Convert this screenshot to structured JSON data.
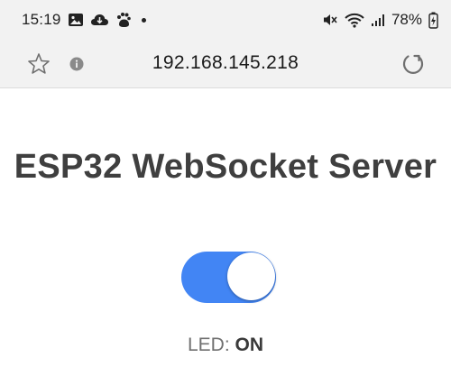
{
  "status_bar": {
    "time": "15:19",
    "battery_percent": "78%",
    "icons": [
      "image-icon",
      "cloud-download-icon",
      "paw-icon",
      "notification-dot-icon",
      "mute-icon",
      "wifi-icon",
      "signal-icon",
      "battery-charging-icon"
    ]
  },
  "browser": {
    "url": "192.168.145.218",
    "icons": [
      "star-icon",
      "info-icon",
      "reload-icon"
    ]
  },
  "page": {
    "title": "ESP32 WebSocket Server",
    "toggle_on": true,
    "accent_color": "#4285f4",
    "led_label": "LED: ",
    "led_state": "ON"
  }
}
